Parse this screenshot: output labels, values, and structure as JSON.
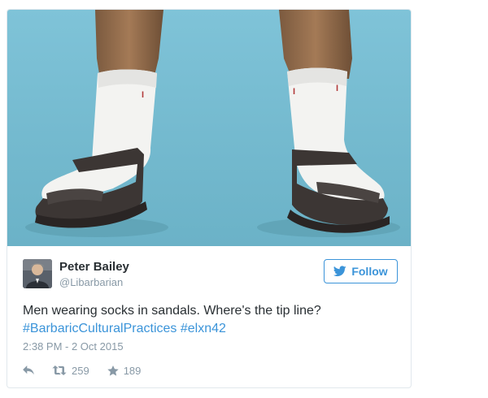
{
  "tweet": {
    "author_name": "Peter Bailey",
    "author_handle": "@Libarbarian",
    "follow_label": "Follow",
    "text": "Men wearing socks in sandals. Where's the tip line?",
    "hashtags": [
      "#BarbaricCulturalPractices",
      "#elxn42"
    ],
    "timestamp": "2:38 PM - 2 Oct 2015",
    "retweet_count": "259",
    "like_count": "189"
  },
  "colors": {
    "brand_blue": "#3b94d9",
    "muted": "#8899a6",
    "text": "#292f33",
    "photo_background": "#7fc3d8"
  },
  "icons": [
    "bird-icon",
    "reply-icon",
    "retweet-icon",
    "star-icon"
  ]
}
